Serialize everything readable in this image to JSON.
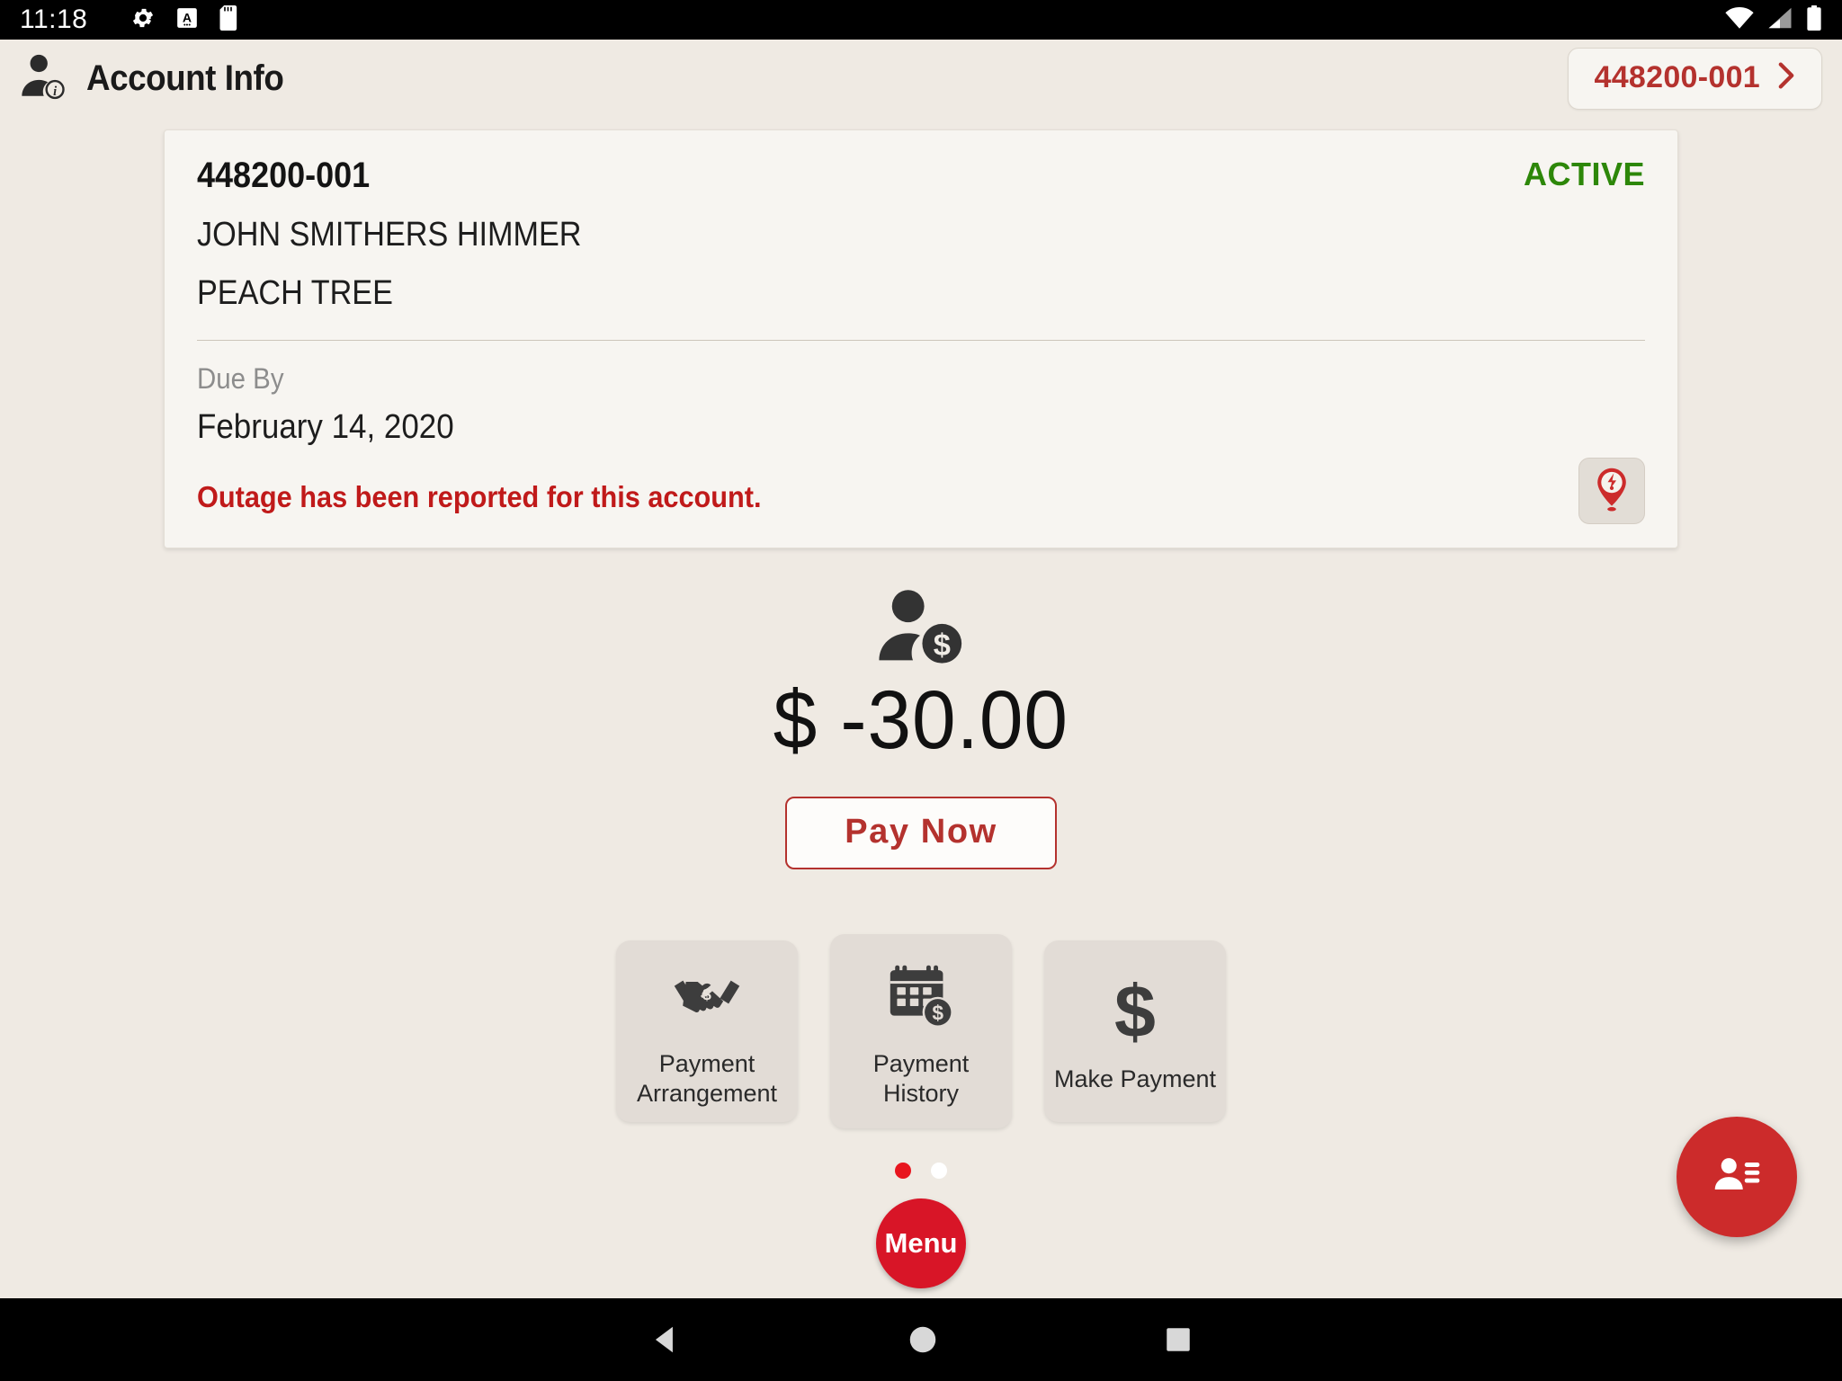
{
  "statusbar": {
    "time": "11:18",
    "left_icons": [
      "gear-icon",
      "a-badge-icon",
      "sd-card-icon"
    ],
    "right_icons": [
      "wifi-icon",
      "cell-signal-icon",
      "battery-icon"
    ]
  },
  "appbar": {
    "icon": "account-info-icon",
    "title": "Account Info",
    "account_chip": {
      "label": "448200-001",
      "chevron": "›",
      "accent_color": "#b4322e"
    }
  },
  "account_card": {
    "account_number": "448200-001",
    "status": "ACTIVE",
    "status_color": "#2d8709",
    "customer_name": "JOHN SMITHERS HIMMER",
    "address": "PEACH TREE",
    "due_by_label": "Due By",
    "due_by_date": "February 14, 2020",
    "outage_message": "Outage has been reported for this account.",
    "outage_color": "#c01a1a",
    "outage_button_icon": "outage-pin-icon"
  },
  "balance": {
    "icon": "customer-balance-icon",
    "amount": "$ -30.00",
    "pay_now_label": "Pay Now",
    "pay_now_color": "#b4322e"
  },
  "tiles": [
    {
      "icon": "handshake-dollar-icon",
      "label": "Payment\nArrangement",
      "line1": "Payment",
      "line2": "Arrangement",
      "size": "small"
    },
    {
      "icon": "calendar-dollar-icon",
      "label": "Payment\nHistory",
      "line1": "Payment",
      "line2": "History",
      "size": "large"
    },
    {
      "icon": "dollar-sign-icon",
      "label": "Make Payment",
      "line1": "Make Payment",
      "line2": "",
      "size": "small"
    }
  ],
  "pagination": {
    "total": 2,
    "active_index": 0,
    "active_color": "#e8161f",
    "inactive_color": "#ffffff"
  },
  "menu_fab": {
    "label": "Menu",
    "color": "#d81527"
  },
  "contact_fab": {
    "icon": "contact-card-icon",
    "color": "#cc2b2b"
  },
  "navbar": {
    "back": "nav-back-icon",
    "home": "nav-home-icon",
    "recents": "nav-recents-icon"
  }
}
